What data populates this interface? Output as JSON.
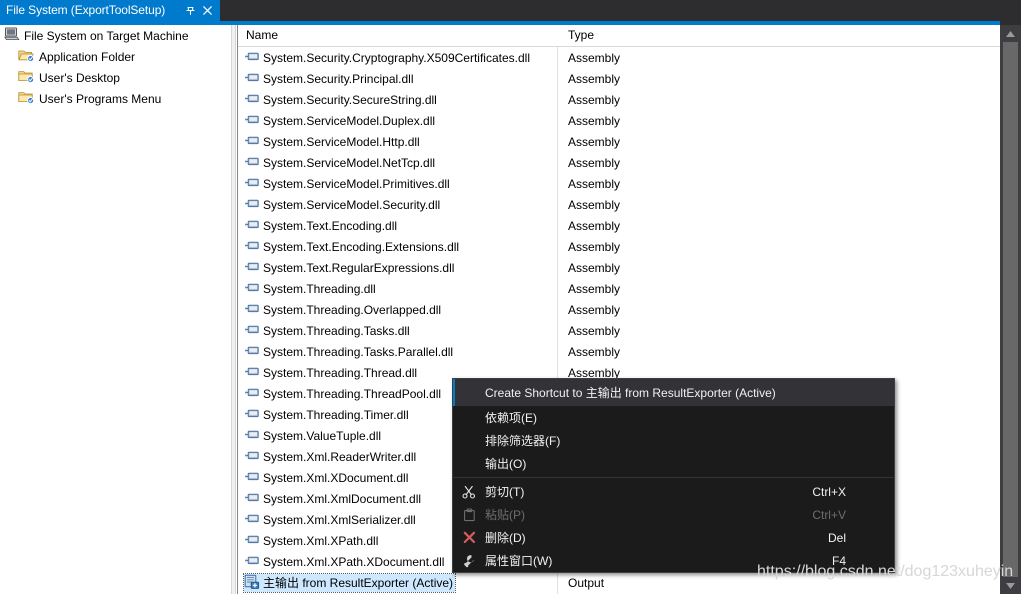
{
  "tab": {
    "title": "File System (ExportToolSetup)",
    "pin_icon": "pin-icon",
    "close_icon": "close-icon"
  },
  "tree": {
    "items": [
      {
        "label": "File System on Target Machine",
        "icon": "computer-icon",
        "indent": 0
      },
      {
        "label": "Application Folder",
        "icon": "folder-open-icon",
        "indent": 1
      },
      {
        "label": "User's Desktop",
        "icon": "folder-icon",
        "indent": 1
      },
      {
        "label": "User's Programs Menu",
        "icon": "folder-icon",
        "indent": 1
      }
    ]
  },
  "list": {
    "columns": {
      "name": "Name",
      "type": "Type"
    },
    "rows": [
      {
        "name": "System.Security.Cryptography.X509Certificates.dll",
        "type": "Assembly",
        "icon": "assembly-icon"
      },
      {
        "name": "System.Security.Principal.dll",
        "type": "Assembly",
        "icon": "assembly-icon"
      },
      {
        "name": "System.Security.SecureString.dll",
        "type": "Assembly",
        "icon": "assembly-icon"
      },
      {
        "name": "System.ServiceModel.Duplex.dll",
        "type": "Assembly",
        "icon": "assembly-icon"
      },
      {
        "name": "System.ServiceModel.Http.dll",
        "type": "Assembly",
        "icon": "assembly-icon"
      },
      {
        "name": "System.ServiceModel.NetTcp.dll",
        "type": "Assembly",
        "icon": "assembly-icon"
      },
      {
        "name": "System.ServiceModel.Primitives.dll",
        "type": "Assembly",
        "icon": "assembly-icon"
      },
      {
        "name": "System.ServiceModel.Security.dll",
        "type": "Assembly",
        "icon": "assembly-icon"
      },
      {
        "name": "System.Text.Encoding.dll",
        "type": "Assembly",
        "icon": "assembly-icon"
      },
      {
        "name": "System.Text.Encoding.Extensions.dll",
        "type": "Assembly",
        "icon": "assembly-icon"
      },
      {
        "name": "System.Text.RegularExpressions.dll",
        "type": "Assembly",
        "icon": "assembly-icon"
      },
      {
        "name": "System.Threading.dll",
        "type": "Assembly",
        "icon": "assembly-icon"
      },
      {
        "name": "System.Threading.Overlapped.dll",
        "type": "Assembly",
        "icon": "assembly-icon"
      },
      {
        "name": "System.Threading.Tasks.dll",
        "type": "Assembly",
        "icon": "assembly-icon"
      },
      {
        "name": "System.Threading.Tasks.Parallel.dll",
        "type": "Assembly",
        "icon": "assembly-icon"
      },
      {
        "name": "System.Threading.Thread.dll",
        "type": "Assembly",
        "icon": "assembly-icon"
      },
      {
        "name": "System.Threading.ThreadPool.dll",
        "type": "",
        "icon": "assembly-icon"
      },
      {
        "name": "System.Threading.Timer.dll",
        "type": "",
        "icon": "assembly-icon"
      },
      {
        "name": "System.ValueTuple.dll",
        "type": "",
        "icon": "assembly-icon"
      },
      {
        "name": "System.Xml.ReaderWriter.dll",
        "type": "",
        "icon": "assembly-icon"
      },
      {
        "name": "System.Xml.XDocument.dll",
        "type": "",
        "icon": "assembly-icon"
      },
      {
        "name": "System.Xml.XmlDocument.dll",
        "type": "",
        "icon": "assembly-icon"
      },
      {
        "name": "System.Xml.XmlSerializer.dll",
        "type": "",
        "icon": "assembly-icon"
      },
      {
        "name": "System.Xml.XPath.dll",
        "type": "",
        "icon": "assembly-icon"
      },
      {
        "name": "System.Xml.XPath.XDocument.dll",
        "type": "",
        "icon": "assembly-icon"
      },
      {
        "name": "主输出 from ResultExporter (Active)",
        "type": "Output",
        "icon": "output-icon",
        "selected": true
      }
    ]
  },
  "context_menu": {
    "items": [
      {
        "label": "Create Shortcut to 主输出 from ResultExporter (Active)",
        "shortcut": "",
        "icon": "",
        "highlighted": true
      },
      {
        "label": "依赖项(E)",
        "shortcut": "",
        "icon": ""
      },
      {
        "label": "排除筛选器(F)",
        "shortcut": "",
        "icon": ""
      },
      {
        "label": "输出(O)",
        "shortcut": "",
        "icon": ""
      },
      {
        "separator": true
      },
      {
        "label": "剪切(T)",
        "shortcut": "Ctrl+X",
        "icon": "scissors-icon"
      },
      {
        "label": "粘贴(P)",
        "shortcut": "Ctrl+V",
        "icon": "clipboard-icon",
        "disabled": true
      },
      {
        "label": "删除(D)",
        "shortcut": "Del",
        "icon": "delete-x-icon"
      },
      {
        "label": "属性窗口(W)",
        "shortcut": "F4",
        "icon": "wrench-icon"
      }
    ]
  },
  "scrollbar": {
    "up_icon": "scroll-up-arrow-icon",
    "down_icon": "scroll-down-arrow-icon"
  },
  "watermark": {
    "text": "https://blog.csdn.net/dog123xuheyin"
  },
  "colors": {
    "tab_active": "#007acc",
    "menu_bg": "#1b1b1c",
    "menu_highlight": "#333337",
    "selection": "#cde8ff",
    "chrome_dark": "#2d2d30",
    "delete_red": "#d65c5c"
  }
}
